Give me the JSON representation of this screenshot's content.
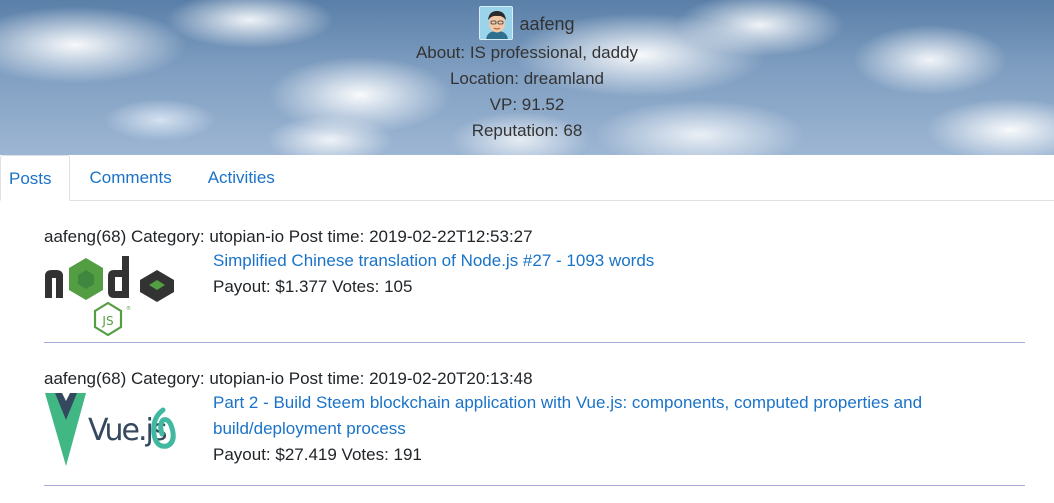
{
  "profile": {
    "username": "aafeng",
    "about": "About: IS professional, daddy",
    "location": "Location: dreamland",
    "vp": "VP: 91.52",
    "reputation": "Reputation: 68"
  },
  "tabs": [
    {
      "label": "Posts",
      "active": true
    },
    {
      "label": "Comments",
      "active": false
    },
    {
      "label": "Activities",
      "active": false
    }
  ],
  "posts": [
    {
      "meta": "aafeng(68) Category: utopian-io Post time: 2019-02-22T12:53:27",
      "thumbnail": "nodejs-logo",
      "title": "Simplified Chinese translation of Node.js #27 - 1093 words",
      "stats": "Payout: $1.377 Votes: 105"
    },
    {
      "meta": "aafeng(68) Category: utopian-io Post time: 2019-02-20T20:13:48",
      "thumbnail": "vuejs-logo",
      "title": "Part 2 - Build Steem blockchain application with Vue.js: components, computed properties and build/deployment process",
      "stats": "Payout: $27.419 Votes: 191"
    }
  ],
  "colors": {
    "link": "#1a73c8",
    "divider": "#a7a9d6",
    "node_green": "#539e43",
    "node_dark": "#333333",
    "vue_green": "#41b883",
    "vue_dark": "#35495e",
    "sky": "#7f9ec1"
  }
}
